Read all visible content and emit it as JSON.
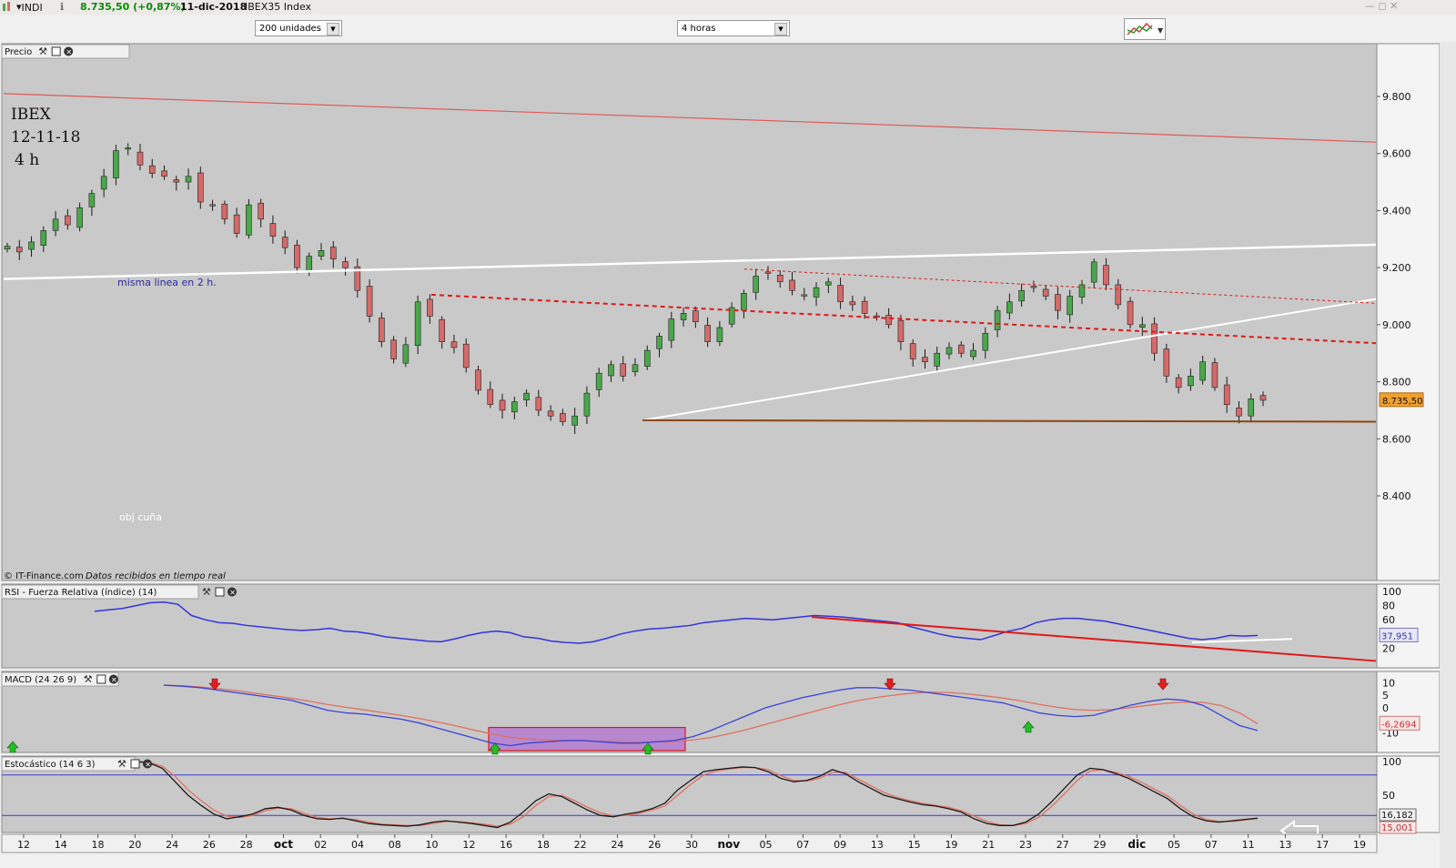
{
  "header": {
    "symbol": "INDI",
    "price": "8.735,50 (+0,87%)",
    "date": "11-dic-2018",
    "instrument": "IBEX35 Index"
  },
  "toolbar": {
    "units_select": "200 unidades",
    "timeframe_select": "4 horas"
  },
  "colors": {
    "pane_bg": "#c9c9c9",
    "bull": "#49a84a",
    "bear": "#d46a6a",
    "resistance": "#e05a5a",
    "support": "#8b4513",
    "rsi": "#3333dd",
    "macd": "#3a44d8",
    "macd_signal": "#e07060",
    "stoch_k": "#1a1a1a",
    "stoch_d": "#e07060",
    "last_price_bg": "#f0a030"
  },
  "chart_data": [
    {
      "type": "candlestick",
      "panel": "Precio",
      "annotations": [
        "IBEX",
        "12-11-18",
        "4 h",
        "misma linea en 2 h.",
        "obj cuña"
      ],
      "footer": "IT-Finance.com",
      "footer_note": "Datos recibidos en tiempo real",
      "ylim": [
        8250,
        9980
      ],
      "yticks": [
        "9.800",
        "9.600",
        "9.400",
        "9.200",
        "9.000",
        "8.800",
        "8.600",
        "8.400"
      ],
      "last_price_label": "8.735,50",
      "x_ticks": [
        "12",
        "14",
        "18",
        "20",
        "24",
        "26",
        "28",
        "oct",
        "02",
        "04",
        "08",
        "10",
        "12",
        "16",
        "18",
        "22",
        "24",
        "26",
        "30",
        "nov",
        "05",
        "07",
        "09",
        "13",
        "15",
        "19",
        "21",
        "23",
        "27",
        "29",
        "dic",
        "05",
        "07",
        "11",
        "13",
        "17",
        "19"
      ],
      "close_path": [
        9275,
        9255,
        9290,
        9330,
        9370,
        9350,
        9410,
        9460,
        9520,
        9610,
        9620,
        9560,
        9530,
        9520,
        9500,
        9520,
        9430,
        9420,
        9370,
        9320,
        9420,
        9370,
        9310,
        9270,
        9200,
        9240,
        9260,
        9230,
        9200,
        9120,
        9030,
        8940,
        8880,
        8930,
        9080,
        9030,
        8940,
        8920,
        8850,
        8770,
        8720,
        8700,
        8730,
        8760,
        8700,
        8680,
        8660,
        8680,
        8760,
        8830,
        8860,
        8820,
        8860,
        8910,
        8960,
        9020,
        9040,
        9010,
        8940,
        8990,
        9060,
        9110,
        9170,
        9180,
        9150,
        9120,
        9100,
        9130,
        9150,
        9080,
        9070,
        9040,
        9030,
        9000,
        8940,
        8880,
        8870,
        8900,
        8920,
        8900,
        8910,
        8970,
        9050,
        9080,
        9120,
        9130,
        9100,
        9050,
        9100,
        9140,
        9220,
        9140,
        9070,
        9000,
        9000,
        8900,
        8820,
        8780,
        8820,
        8870,
        8780,
        8720,
        8680,
        8740,
        8735
      ],
      "lines": [
        {
          "name": "resistencia",
          "from": [
            "inicio",
            9810
          ],
          "to": [
            "fin",
            9640
          ]
        },
        {
          "name": "cuña superior",
          "from": [
            "inicio",
            9160
          ],
          "to": [
            "fin",
            9280
          ]
        },
        {
          "name": "cuña inferior",
          "from": [
            "26 oct",
            8665
          ],
          "to": [
            "fin",
            9090
          ]
        },
        {
          "name": "soporte",
          "from": [
            "26 oct",
            8665
          ],
          "to": [
            "fin",
            8660
          ]
        },
        {
          "name": "canal rojo",
          "from": [
            "12 oct",
            9105
          ],
          "to": [
            "fin",
            8935
          ]
        },
        {
          "name": "canal rojo fino",
          "from": [
            "5 nov",
            9195
          ],
          "to": [
            "fin",
            9075
          ]
        }
      ]
    },
    {
      "type": "line",
      "panel": "RSI - Fuerza Relativa (índice) (14)",
      "yticks": [
        "100",
        "80",
        "60",
        "40",
        "20"
      ],
      "ylim": [
        0,
        100
      ],
      "last_value": "37,951",
      "series": [
        {
          "values": [
            72,
            74,
            76,
            80,
            84,
            85,
            82,
            66,
            60,
            56,
            55,
            52,
            50,
            48,
            46,
            45,
            46,
            48,
            44,
            43,
            40,
            36,
            34,
            32,
            30,
            29,
            33,
            38,
            42,
            44,
            42,
            36,
            34,
            30,
            28,
            27,
            29,
            34,
            40,
            44,
            47,
            48,
            50,
            52,
            56,
            58,
            60,
            62,
            61,
            60,
            62,
            64,
            66,
            65,
            64,
            62,
            60,
            58,
            56,
            50,
            45,
            40,
            36,
            34,
            32,
            38,
            44,
            48,
            56,
            60,
            62,
            62,
            60,
            58,
            54,
            50,
            46,
            42,
            38,
            34,
            32,
            34,
            38,
            37,
            38
          ]
        }
      ],
      "lines": [
        {
          "name": "directriz bajista RSI",
          "from": [
            "7 nov",
            64
          ],
          "to": [
            "fin",
            2
          ]
        }
      ]
    },
    {
      "type": "line",
      "panel": "MACD (24 26 9)",
      "yticks": [
        "10",
        "5",
        "0",
        "-10"
      ],
      "ylim": [
        -17,
        13
      ],
      "last_values": [
        "-6,2694"
      ],
      "series": [
        {
          "values": [
            9,
            8.6,
            8,
            7,
            6,
            5,
            4,
            3,
            1,
            -1,
            -2,
            -2.5,
            -3.5,
            -4.5,
            -6,
            -8,
            -10,
            -12,
            -14,
            -15,
            -14,
            -13.5,
            -13,
            -13,
            -13.5,
            -14,
            -14,
            -13.5,
            -13,
            -11.5,
            -9,
            -6,
            -3,
            0,
            2,
            4,
            5.5,
            7,
            8,
            8,
            7.5,
            7,
            6,
            5,
            4,
            3,
            2,
            0,
            -2,
            -3,
            -3.5,
            -3,
            -1,
            1,
            2.5,
            3.5,
            3,
            1,
            -3,
            -7,
            -9
          ]
        },
        {
          "values": [
            9,
            8.8,
            8.3,
            7.6,
            6.8,
            5.8,
            4.8,
            3.8,
            2.6,
            1.3,
            0.2,
            -0.8,
            -1.9,
            -3,
            -4.2,
            -5.6,
            -7.1,
            -8.8,
            -10.4,
            -11.7,
            -12.4,
            -12.8,
            -13,
            -13.1,
            -13.3,
            -13.5,
            -13.6,
            -13.5,
            -13.4,
            -12.8,
            -11.8,
            -10.3,
            -8.6,
            -6.6,
            -4.6,
            -2.7,
            -0.8,
            1.1,
            2.8,
            4,
            5,
            5.8,
            6.2,
            6.1,
            5.6,
            4.8,
            3.9,
            2.8,
            1.4,
            0.2,
            -0.7,
            -1,
            -0.7,
            0.1,
            1,
            1.8,
            2.3,
            2.2,
            0.9,
            -2,
            -6.3
          ]
        }
      ],
      "signals": [
        {
          "kind": "venta",
          "at": "26 sep"
        },
        {
          "kind": "venta",
          "at": "14 nov"
        },
        {
          "kind": "venta",
          "at": "4 dic"
        },
        {
          "kind": "compra",
          "at": "12 sep"
        },
        {
          "kind": "compra",
          "at": "17 oct"
        },
        {
          "kind": "compra",
          "at": "26 oct"
        },
        {
          "kind": "compra",
          "at": "24 nov"
        }
      ]
    },
    {
      "type": "line",
      "panel": "Estocástico (14 6 3)",
      "yticks": [
        "100",
        "50",
        "0"
      ],
      "ylim": [
        0,
        100
      ],
      "levels": [
        80,
        20
      ],
      "last_values": [
        "16,182",
        "15,001"
      ],
      "series": [
        {
          "values": [
            100,
            98,
            90,
            70,
            50,
            35,
            22,
            15,
            18,
            22,
            30,
            32,
            28,
            20,
            15,
            14,
            16,
            12,
            8,
            6,
            5,
            4,
            6,
            10,
            12,
            10,
            8,
            5,
            2,
            10,
            25,
            42,
            52,
            48,
            38,
            28,
            20,
            18,
            22,
            25,
            30,
            38,
            58,
            72,
            85,
            88,
            90,
            92,
            91,
            85,
            75,
            70,
            72,
            78,
            88,
            82,
            70,
            60,
            50,
            45,
            40,
            36,
            34,
            30,
            25,
            15,
            8,
            5,
            5,
            10,
            22,
            40,
            60,
            80,
            90,
            88,
            82,
            75,
            65,
            55,
            45,
            30,
            18,
            12,
            10,
            12,
            14,
            16
          ]
        },
        {
          "values": [
            100,
            99,
            93,
            78,
            58,
            42,
            28,
            19,
            17,
            20,
            27,
            31,
            30,
            23,
            17,
            15,
            15,
            14,
            10,
            7,
            6,
            5,
            5,
            8,
            11,
            11,
            9,
            7,
            4,
            7,
            18,
            35,
            48,
            50,
            42,
            32,
            24,
            19,
            20,
            23,
            28,
            34,
            50,
            66,
            80,
            86,
            89,
            91,
            91,
            88,
            79,
            72,
            71,
            75,
            84,
            84,
            74,
            64,
            54,
            47,
            42,
            38,
            35,
            32,
            27,
            19,
            11,
            6,
            5,
            8,
            17,
            33,
            52,
            72,
            86,
            88,
            84,
            78,
            69,
            59,
            49,
            35,
            22,
            14,
            11,
            11,
            13,
            15
          ]
        }
      ]
    }
  ],
  "panels": {
    "precio_title": "Precio",
    "rsi_title": "RSI - Fuerza Relativa (índice) (14)",
    "macd_title": "MACD (24 26 9)",
    "stoch_title": "Estocástico (14 6 3)"
  }
}
